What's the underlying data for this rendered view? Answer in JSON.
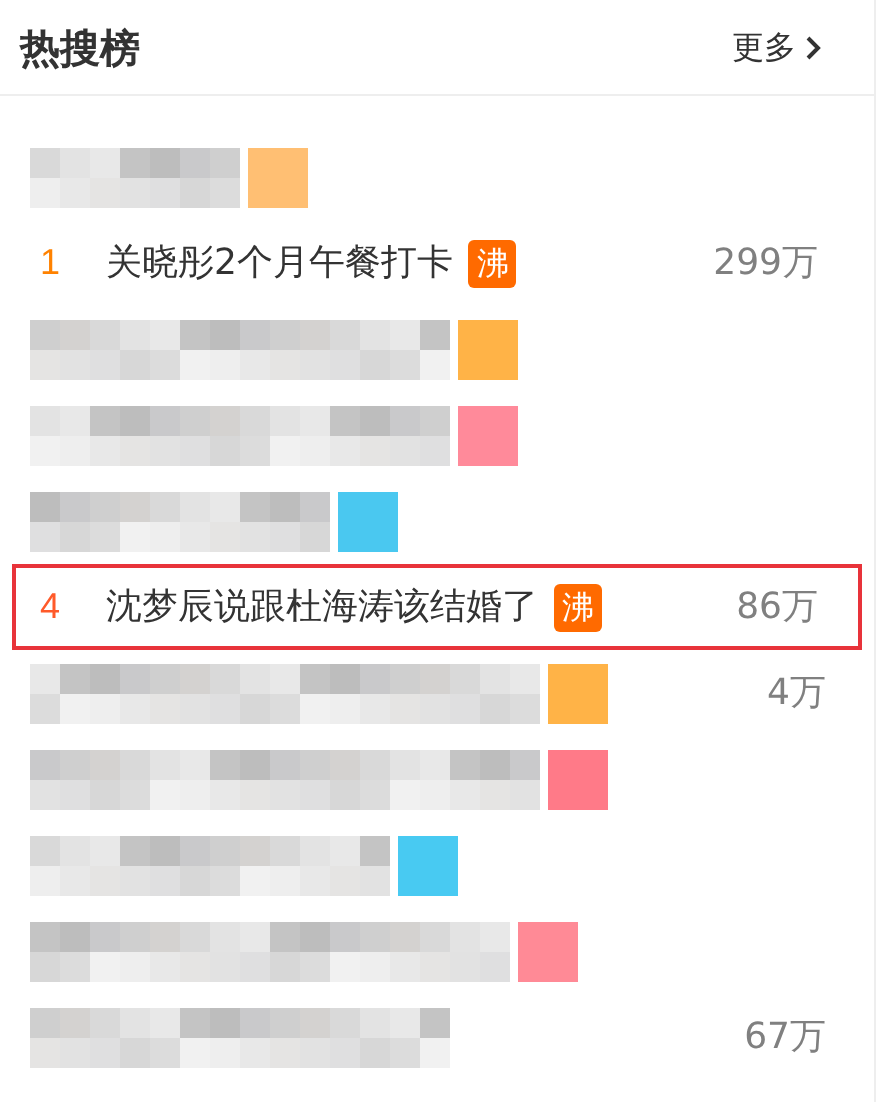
{
  "header": {
    "title": "热搜榜",
    "more": "更多"
  },
  "rows": [
    {
      "kind": "masked",
      "color": "#ffbf73"
    },
    {
      "kind": "item",
      "rank": "1",
      "text": "关晓彤2个月午餐打卡",
      "badge": "沸",
      "count": "299万",
      "highlighted": false
    },
    {
      "kind": "masked",
      "color": "#ffb347"
    },
    {
      "kind": "masked",
      "color": "#ff8a9a"
    },
    {
      "kind": "masked",
      "color": "#4ac8f0"
    },
    {
      "kind": "item",
      "rank": "4",
      "text": "沈梦辰说跟杜海涛该结婚了",
      "badge": "沸",
      "count": "86万",
      "highlighted": true
    },
    {
      "kind": "masked",
      "color": "#ffb347",
      "count": "4万"
    },
    {
      "kind": "masked",
      "color": "#ff7a88"
    },
    {
      "kind": "masked",
      "color": "#48caf2"
    },
    {
      "kind": "masked",
      "color": "#ff8a96"
    },
    {
      "kind": "masked",
      "count": "67万"
    }
  ]
}
